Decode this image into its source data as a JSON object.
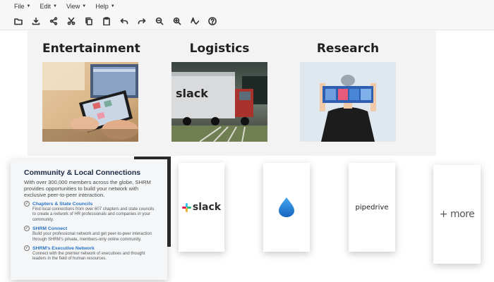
{
  "menu": [
    {
      "label": "File"
    },
    {
      "label": "Edit"
    },
    {
      "label": "View"
    },
    {
      "label": "Help"
    }
  ],
  "toolbar_icons": [
    "folder-icon",
    "download-icon",
    "share-icon",
    "cut-icon",
    "copy-icon",
    "paste-icon",
    "undo-icon",
    "redo-icon",
    "zoom-out-icon",
    "zoom-in-icon",
    "spellcheck-icon",
    "help-icon"
  ],
  "categories": [
    {
      "title": "Entertainment"
    },
    {
      "title": "Logistics"
    },
    {
      "title": "Research"
    }
  ],
  "shrm": {
    "title": "Community & Local Connections",
    "intro": "With over 300,000 members across the globe, SHRM provides opportunities to build your network with exclusive peer-to-peer interaction.",
    "items": [
      {
        "heading": "Chapters & State Councils",
        "body": "Find local connections from over 607 chapters and state councils to create a network of HR professionals and companies in your community."
      },
      {
        "heading": "SHRM Connect",
        "body": "Build your professional network and get peer-to-peer interaction through SHRM's private, members-only online community."
      },
      {
        "heading": "SHRM's Executive Network",
        "body": "Connect with the premier network of executives and thought leaders in the field of human resources."
      }
    ]
  },
  "integrations": {
    "slack": "slack",
    "pipedrive": "pipedrive",
    "more": "+ more"
  }
}
